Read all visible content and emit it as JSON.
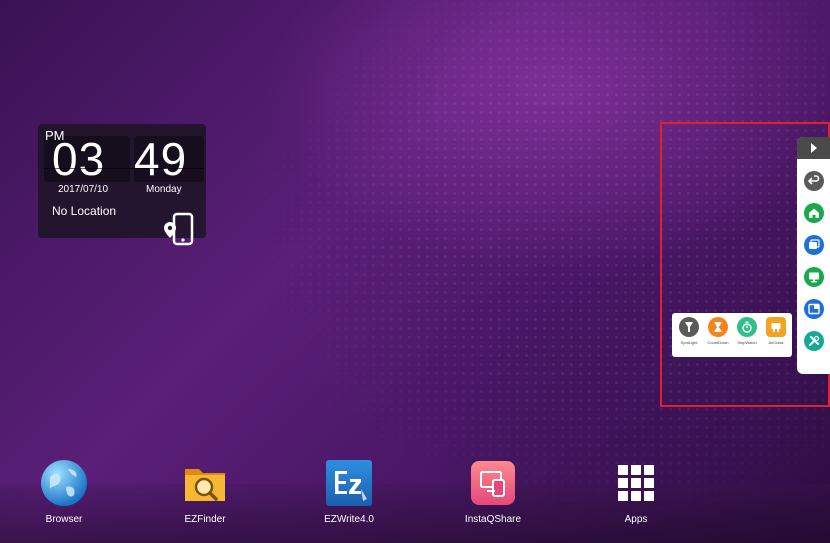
{
  "clock": {
    "ampm": "PM",
    "hours": "03",
    "minutes": "49",
    "date": "2017/07/10",
    "day": "Monday",
    "location": "No Location"
  },
  "toolbar": {
    "buttons": [
      {
        "name": "back-icon",
        "color": "#5a5a5a"
      },
      {
        "name": "home-icon",
        "color": "#1aa84e"
      },
      {
        "name": "windows-icon",
        "color": "#1e6fd9"
      },
      {
        "name": "display-icon",
        "color": "#1aa84e"
      },
      {
        "name": "split-icon",
        "color": "#1e6fd9"
      },
      {
        "name": "tools-icon",
        "color": "#16a99a"
      }
    ]
  },
  "tools": {
    "items": [
      {
        "label": "SpotLight",
        "color": "#5a5a5a"
      },
      {
        "label": "CountDown",
        "color": "#f5841f"
      },
      {
        "label": "StopWatch",
        "color": "#2fc08a"
      },
      {
        "label": "AirClass",
        "color": "#f5a21f"
      }
    ]
  },
  "dock": {
    "apps": [
      {
        "label": "Browser"
      },
      {
        "label": "EZFinder"
      },
      {
        "label": "EZWrite4.0"
      },
      {
        "label": "InstaQShare"
      },
      {
        "label": "Apps"
      }
    ]
  }
}
